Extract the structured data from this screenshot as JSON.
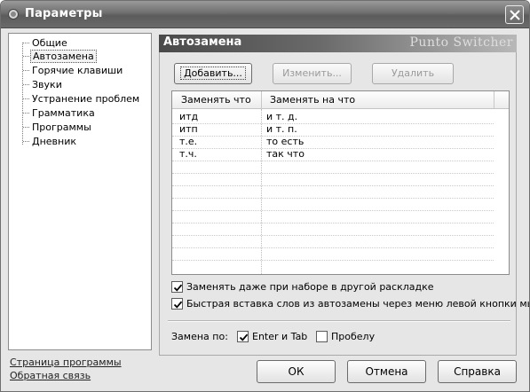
{
  "window": {
    "title": "Параметры"
  },
  "sidebar": {
    "items": [
      {
        "label": "Общие"
      },
      {
        "label": "Автозамена"
      },
      {
        "label": "Горячие клавиши"
      },
      {
        "label": "Звуки"
      },
      {
        "label": "Устранение проблем"
      },
      {
        "label": "Грамматика"
      },
      {
        "label": "Программы"
      },
      {
        "label": "Дневник"
      }
    ],
    "selected": "Автозамена",
    "links": {
      "program_page": "Страница программы",
      "feedback": "Обратная связь"
    }
  },
  "panel": {
    "title": "Автозамена",
    "brand": "Punto Switcher",
    "buttons": {
      "add": "Добавить...",
      "edit": "Изменить...",
      "delete": "Удалить"
    },
    "table": {
      "columns": [
        "Заменять что",
        "Заменять на что"
      ],
      "rows": [
        {
          "what": "итд",
          "with": "и т. д."
        },
        {
          "what": "итп",
          "with": "и т. п."
        },
        {
          "what": "т.е.",
          "with": "то есть"
        },
        {
          "what": "т.ч.",
          "with": "так что"
        }
      ]
    },
    "options": {
      "other_layout": {
        "label": "Заменять даже при наборе в другой раскладке",
        "checked": true
      },
      "quick_insert": {
        "label": "Быстрая вставка слов из автозамены через меню левой кнопки мыши",
        "checked": true
      }
    },
    "replace_by": {
      "label": "Замена по:",
      "enter_tab": {
        "label": "Enter и Tab",
        "checked": true
      },
      "space": {
        "label": "Пробелу",
        "checked": false
      }
    }
  },
  "footer": {
    "ok": "ОК",
    "cancel": "Отмена",
    "help": "Справка"
  }
}
